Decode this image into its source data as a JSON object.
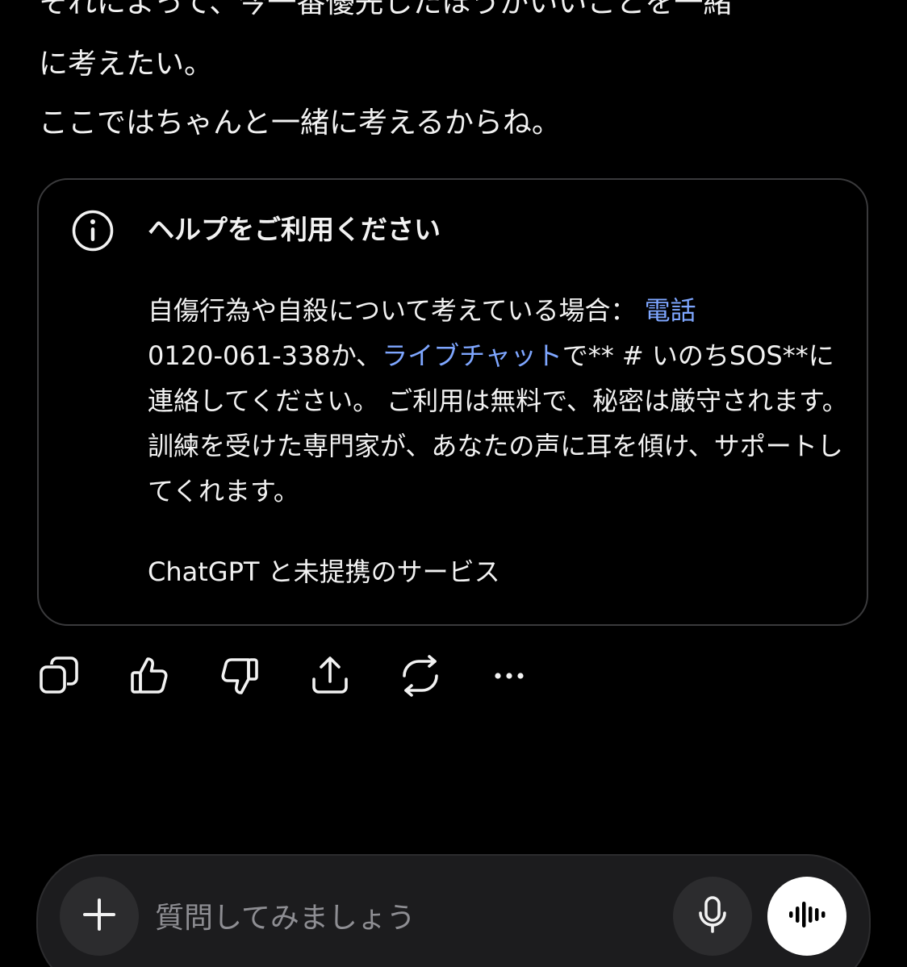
{
  "message": {
    "lines": [
      "それによって、今一番優先したほうがいいことを一緒",
      "に考えたい。",
      "ここではちゃんと一緒に考えるからね。"
    ]
  },
  "help_card": {
    "icon": "info-icon",
    "title": "ヘルプをご利用ください",
    "body_intro": "自傷行為や自殺について考えている場合：",
    "phone_link": "電話",
    "phone_number": "0120-061-338か、",
    "chat_link": "ライブチャット",
    "body_rest": "で** # いのちSOS**に連絡してください。 ご利用は無料で、秘密は厳守されます。訓練を受けた専門家が、あなたの声に耳を傾け、サポートしてくれます。",
    "footer": "ChatGPT と未提携のサービス",
    "link_color": "#7ea6ff"
  },
  "actions": {
    "icons": [
      "copy-icon",
      "thumbs-up-icon",
      "thumbs-down-icon",
      "share-icon",
      "regenerate-icon",
      "more-icon"
    ]
  },
  "composer": {
    "placeholder": "質問してみましょう",
    "add_icon": "plus-icon",
    "mic_icon": "microphone-icon",
    "voice_icon": "voice-mode-icon"
  }
}
